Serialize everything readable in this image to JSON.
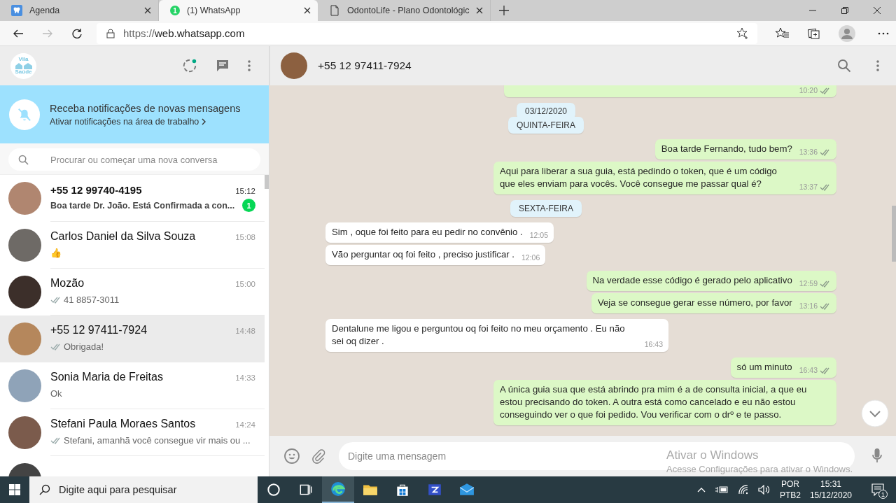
{
  "browser": {
    "tabs": [
      {
        "title": "Agenda",
        "selected": false,
        "kind": "tooth"
      },
      {
        "title": "(1) WhatsApp",
        "selected": true,
        "kind": "count",
        "favicon_text": "1"
      },
      {
        "title": "OdontoLife - Plano Odontológic",
        "selected": false,
        "kind": "document"
      }
    ],
    "address": {
      "scheme": "https://",
      "host": "web.whatsapp.com"
    }
  },
  "sidebar": {
    "logo": {
      "line1": "Vila",
      "line2": "Saúde"
    },
    "notification": {
      "title": "Receba notificações de novas mensagens",
      "link": "Ativar notificações na área de trabalho"
    },
    "search": {
      "placeholder": "Procurar ou começar uma nova conversa"
    },
    "chats": [
      {
        "name": "+55 12 99740-4195",
        "time": "15:12",
        "preview": "Boa tarde Dr. João. Está  Confirmada  a con...",
        "unread": "1",
        "ticks": false,
        "selected": false
      },
      {
        "name": "Carlos Daniel da Silva Souza",
        "time": "15:08",
        "preview": "👍",
        "ticks": false,
        "selected": false
      },
      {
        "name": "Mozão",
        "time": "15:00",
        "preview": "41 8857-3011",
        "ticks": true,
        "selected": false
      },
      {
        "name": "+55 12 97411-7924",
        "time": "14:48",
        "preview": "Obrigada!",
        "ticks": true,
        "selected": true
      },
      {
        "name": "Sonia Maria de Freitas",
        "time": "14:33",
        "preview": "Ok",
        "ticks": false,
        "selected": false
      },
      {
        "name": "Stefani Paula Moraes Santos",
        "time": "14:24",
        "preview": "Stefani, amanhã você consegue vir mais ou ...",
        "ticks": true,
        "selected": false
      }
    ]
  },
  "chat": {
    "contact": "+55 12 97411-7924",
    "messages": [
      {
        "kind": "out",
        "time": "10:20"
      },
      {
        "kind": "day",
        "text": "03/12/2020"
      },
      {
        "kind": "day",
        "text": "QUINTA-FEIRA"
      },
      {
        "kind": "out",
        "text": "Boa tarde Fernando, tudo bem?",
        "time": "13:36"
      },
      {
        "kind": "out",
        "text": "Aqui para liberar a sua guia, está pedindo o token, que é um código que eles enviam para vocês. Você consegue me passar qual é?",
        "time": "13:37"
      },
      {
        "kind": "day",
        "text": "SEXTA-FEIRA"
      },
      {
        "kind": "in",
        "text": "Sim , oque foi feito para eu pedir no convênio .",
        "time": "12:05"
      },
      {
        "kind": "in",
        "text": "Vão perguntar oq foi feito , preciso justificar .",
        "time": "12:06"
      },
      {
        "kind": "out",
        "text": "Na verdade esse código é gerado pelo aplicativo",
        "time": "12:59"
      },
      {
        "kind": "out",
        "text": "Veja se consegue gerar esse número, por favor",
        "time": "13:16"
      },
      {
        "kind": "in",
        "text": "Dentalune me ligou e perguntou oq foi feito no meu orçamento . Eu não sei oq dizer .",
        "time": "16:43"
      },
      {
        "kind": "out",
        "text": "só um minuto",
        "time": "16:43"
      },
      {
        "kind": "out",
        "text": "A única guia sua que está abrindo pra mim é a de consulta inicial, a que eu estou precisando do token. A outra está como cancelado e eu não estou conseguindo ver o que foi pedido. Vou verificar com o drº e te passo."
      }
    ],
    "composer": {
      "placeholder": "Digite uma mensagem"
    }
  },
  "windows_notice": {
    "title": "Ativar o Windows",
    "text": "Acesse Configurações para ativar o Windows."
  },
  "taskbar": {
    "search_placeholder": "Digite aqui para pesquisar",
    "apps": [
      {
        "kind": "cortana",
        "selected": false
      },
      {
        "kind": "taskview",
        "selected": false
      },
      {
        "kind": "edge",
        "selected": true
      },
      {
        "kind": "explorer",
        "selected": false
      },
      {
        "kind": "store",
        "selected": false
      },
      {
        "kind": "app",
        "selected": false
      },
      {
        "kind": "mail",
        "selected": false
      }
    ],
    "language": [
      "POR",
      "PTB2"
    ],
    "clock": [
      "15:31",
      "15/12/2020"
    ],
    "notifications": "1"
  }
}
